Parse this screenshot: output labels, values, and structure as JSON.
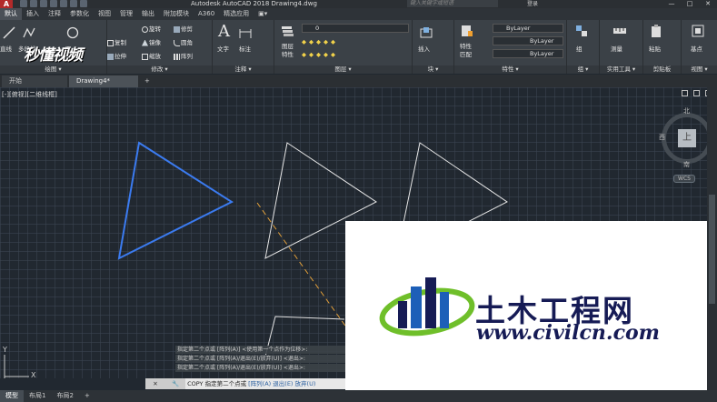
{
  "titlebar": {
    "app_letter": "A",
    "title": "Autodesk AutoCAD 2018    Drawing4.dwg",
    "search_placeholder": "键入关键字或短语",
    "login": "登录",
    "min": "—",
    "max": "□",
    "close": "✕"
  },
  "ribbon_tabs": [
    "默认",
    "插入",
    "注释",
    "参数化",
    "视图",
    "管理",
    "输出",
    "附加模块",
    "A360",
    "精选应用",
    "▣▾"
  ],
  "ribbon": {
    "draw": {
      "label": "绘图 ▾",
      "line": "直线",
      "polyline": "多段线",
      "circle": "圆"
    },
    "modify": {
      "label": "修改 ▾",
      "items": [
        "旋转",
        "修剪",
        "复制",
        "镜像",
        "圆角",
        "拉伸",
        "缩放",
        "阵列"
      ]
    },
    "annotation": {
      "label": "注释 ▾",
      "text": "文字",
      "dim": "标注"
    },
    "layers": {
      "label": "图层 ▾",
      "properties": "图层\n特性",
      "current": "0"
    },
    "block": {
      "label": "块 ▾",
      "insert": "插入"
    },
    "properties": {
      "label": "特性 ▾",
      "match": "特性\n匹配",
      "bylayer1": "ByLayer",
      "bylayer2": "ByLayer",
      "bylayer3": "ByLayer"
    },
    "groups": {
      "label": "组 ▾",
      "group": "组"
    },
    "utilities": {
      "label": "实用工具 ▾",
      "measure": "测量"
    },
    "clipboard": {
      "label": "剪贴板",
      "paste": "粘贴"
    },
    "view": {
      "label": "视图 ▾",
      "base": "基点"
    }
  },
  "logo_overlay": "秒懂视频",
  "doc_tabs": [
    {
      "label": "开始"
    },
    {
      "label": "Drawing4*"
    }
  ],
  "add_tab": "+",
  "viewport": {
    "label": "[-][俯视][二维线框]"
  },
  "viewcube": {
    "top": "上",
    "north": "北",
    "south": "南",
    "west": "西",
    "east": "东",
    "wcs": "WCS"
  },
  "command": {
    "history": [
      "指定第二个点或 [阵列(A)] <使用第一个点作为位移>:",
      "指定第二个点或 [阵列(A)/退出(E)/放弃(U)] <退出>:",
      "指定第二个点或 [阵列(A)/退出(E)/放弃(U)] <退出>:"
    ],
    "prompt_cmd": "COPY",
    "prompt_text": "指定第二个点或",
    "kw1": "[阵列(A)",
    "kw2": "退出(E)",
    "kw3": "放弃(U)",
    "close_icon": "✕",
    "search_icon": "🔧"
  },
  "layout_tabs": [
    "模型",
    "布局1",
    "布局2",
    "+"
  ],
  "ucs": {
    "y": "Y",
    "x": "X"
  },
  "watermark": {
    "title": "土木工程网",
    "url": "www.civilcn.com"
  },
  "colors": {
    "selected": "#3b7bf0",
    "triangle": "#e6e6e6",
    "dashed": "#e8a33a",
    "wm_blue": "#161b55",
    "wm_green": "#6fbf2a"
  }
}
